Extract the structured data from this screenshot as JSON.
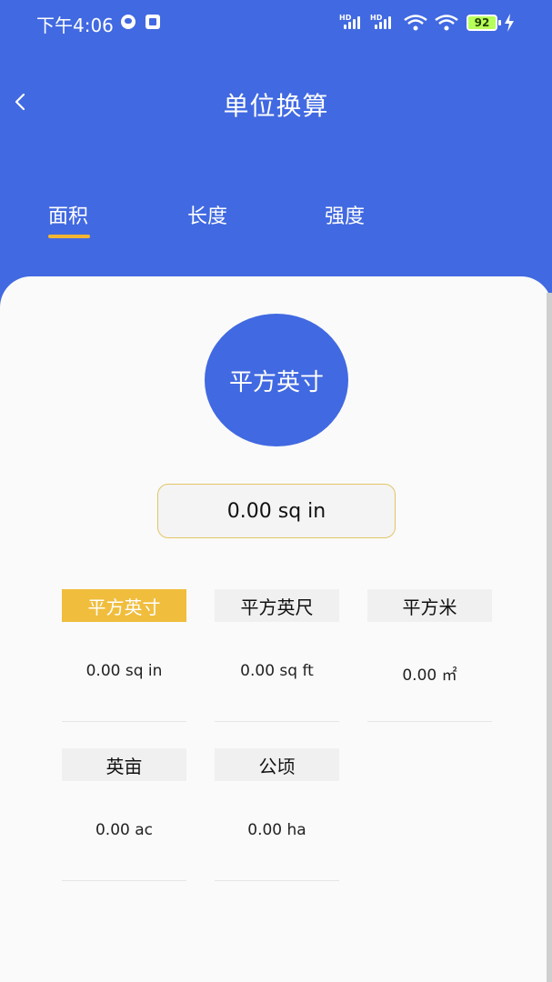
{
  "status": {
    "time": "下午4:06",
    "hd1": "HD",
    "hd2": "HD",
    "battery": "92"
  },
  "header": {
    "title": "单位换算"
  },
  "tabs": [
    {
      "label": "面积",
      "active": true
    },
    {
      "label": "长度",
      "active": false
    },
    {
      "label": "强度",
      "active": false
    }
  ],
  "current_unit": "平方英寸",
  "current_value": "0.00 sq in",
  "units": [
    {
      "label": "平方英寸",
      "value": "0.00 sq in",
      "active": true
    },
    {
      "label": "平方英尺",
      "value": "0.00 sq ft",
      "active": false
    },
    {
      "label": "平方米",
      "value": "0.00 ㎡",
      "active": false
    },
    {
      "label": "英亩",
      "value": "0.00 ac",
      "active": false
    },
    {
      "label": "公顷",
      "value": "0.00 ha",
      "active": false
    }
  ],
  "colors": {
    "primary": "#4169e1",
    "accent": "#f0bd3d",
    "background": "#fafafa"
  }
}
